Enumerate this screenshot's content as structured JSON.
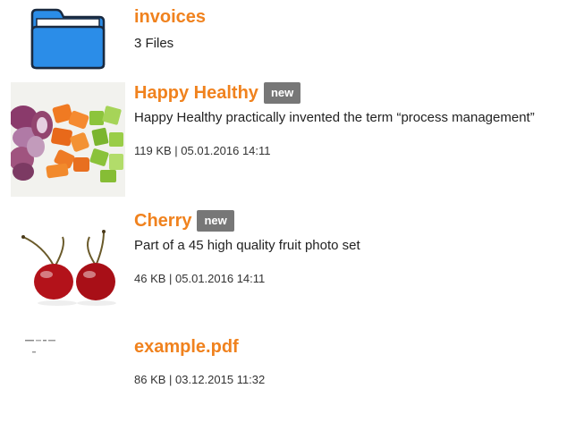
{
  "items": [
    {
      "kind": "folder",
      "title": "invoices",
      "description": "3 Files",
      "icon": "folder-icon"
    },
    {
      "kind": "image",
      "title": "Happy Healthy",
      "badge": "new",
      "description": "Happy Healthy practically invented the term “process management”",
      "meta": "119 KB | 05.01.2016 14:11",
      "thumbnail": "vegetables-thumbnail"
    },
    {
      "kind": "image",
      "title": "Cherry",
      "badge": "new",
      "description": "Part of a 45 high quality fruit photo set",
      "meta": "46 KB | 05.01.2016 14:11",
      "thumbnail": "cherry-thumbnail"
    },
    {
      "kind": "pdf",
      "title": "example.pdf",
      "meta": "86 KB | 03.12.2015 11:32",
      "thumbnail": "pdf-thumbnail"
    }
  ],
  "colors": {
    "title": "#f0821e",
    "badge_bg": "#777777",
    "folder_blue": "#2b8de8"
  }
}
